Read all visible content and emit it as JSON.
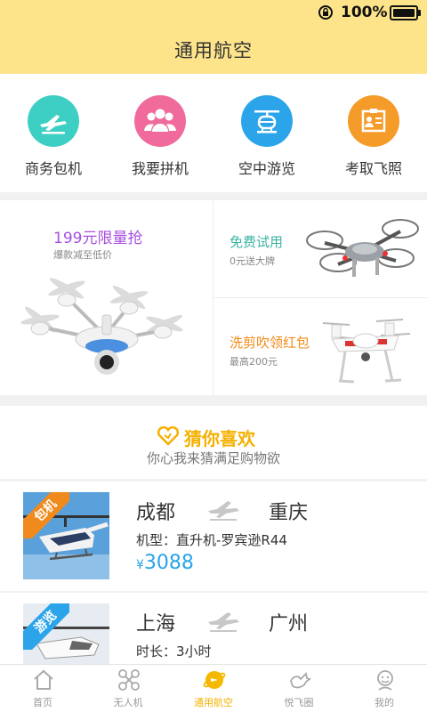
{
  "status": {
    "battery": "100%"
  },
  "header": {
    "title": "通用航空"
  },
  "services": [
    {
      "label": "商务包机",
      "icon": "plane-icon",
      "color": "#3dcfc3"
    },
    {
      "label": "我要拼机",
      "icon": "group-icon",
      "color": "#f06b9c"
    },
    {
      "label": "空中游览",
      "icon": "helicopter-icon",
      "color": "#2ca4ea"
    },
    {
      "label": "考取飞照",
      "icon": "license-icon",
      "color": "#f59b2a"
    }
  ],
  "promo": {
    "main": {
      "title": "199元限量抢",
      "subtitle": "爆款减至低价"
    },
    "trial": {
      "title": "免费试用",
      "subtitle": "0元送大牌"
    },
    "redpack": {
      "title": "洗剪吹领红包",
      "subtitle": "最高200元"
    }
  },
  "guess": {
    "title": "猜你喜欢",
    "subtitle": "你心我来猜满足购物欲"
  },
  "flights": [
    {
      "tag": "包机",
      "tag_color": "#f08a1c",
      "from": "成都",
      "to": "重庆",
      "info": "机型：直升机-罗宾逊R44",
      "currency": "¥",
      "price": "3088"
    },
    {
      "tag": "游览",
      "tag_color": "#2ca4ea",
      "from": "上海",
      "to": "广州",
      "info": "时长：3小时"
    }
  ],
  "tabs": [
    {
      "label": "首页",
      "icon": "home-icon"
    },
    {
      "label": "无人机",
      "icon": "drone-icon"
    },
    {
      "label": "通用航空",
      "icon": "planet-icon",
      "active": true
    },
    {
      "label": "悦飞圈",
      "icon": "bird-icon"
    },
    {
      "label": "我的",
      "icon": "profile-icon"
    }
  ],
  "colors": {
    "header_bg": "#fde48b",
    "accent": "#f2b100",
    "price": "#2aa3e7"
  }
}
